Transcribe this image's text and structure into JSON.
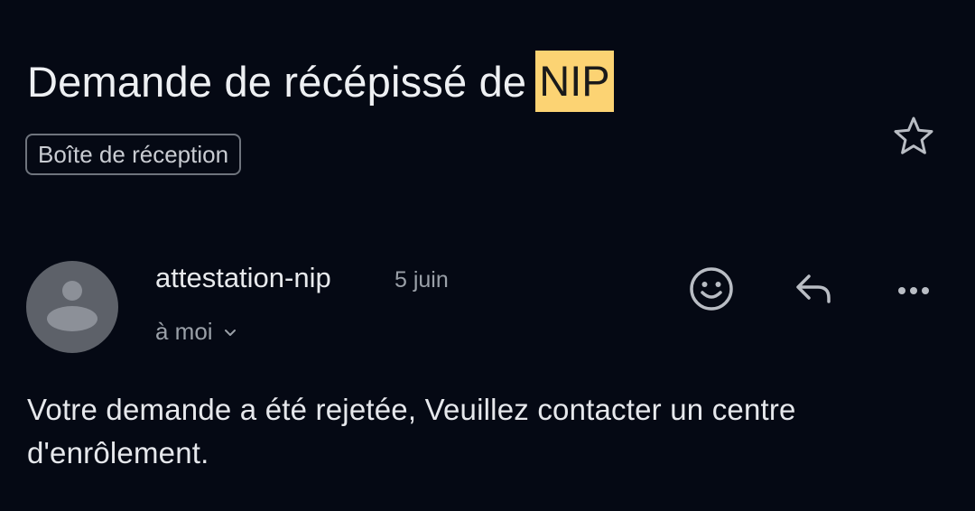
{
  "email": {
    "subject_text": "Demande de récépissé de",
    "subject_highlight": "NIP",
    "label": "Boîte de réception",
    "sender": {
      "name": "attestation-nip",
      "date": "5 juin",
      "recipient": "à moi"
    },
    "body": "Votre demande a été rejetée, Veuillez contacter un centre d'enrôlement."
  },
  "icons": {
    "star": "star-icon",
    "emoji": "smiley-icon",
    "reply": "reply-arrow-icon",
    "more": "more-dots-icon",
    "avatar": "person-icon",
    "chevron": "chevron-down-icon"
  },
  "colors": {
    "background": "#050914",
    "highlight": "#fcd373",
    "avatar": "#5d6169"
  }
}
